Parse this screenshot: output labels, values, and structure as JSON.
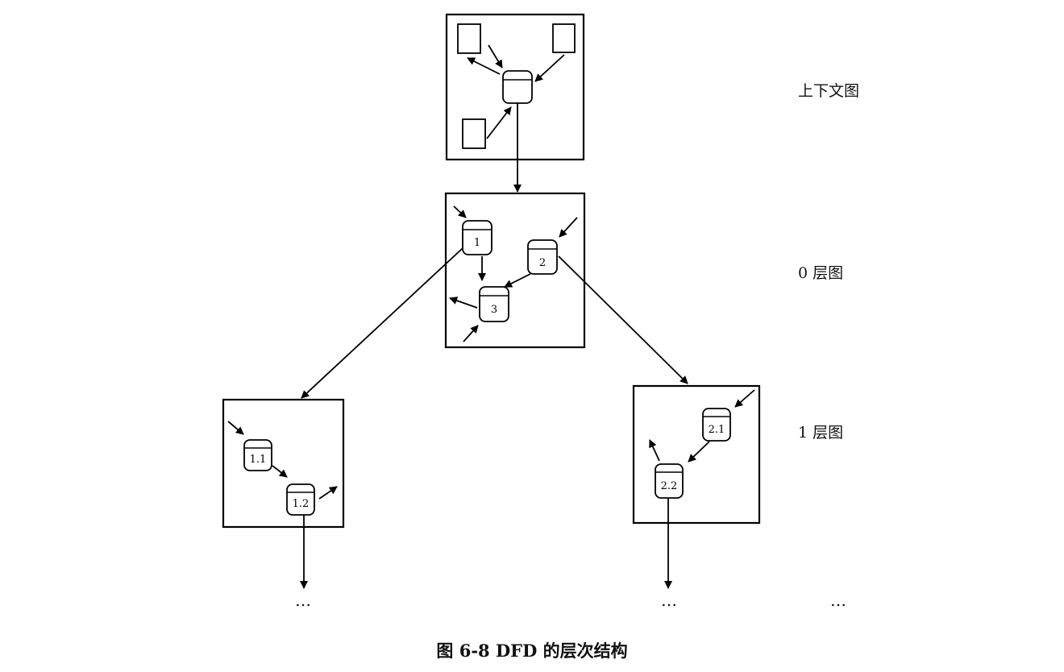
{
  "labels": {
    "context": "上下文图",
    "level0": "0 层图",
    "level1": "1 层图"
  },
  "processes": {
    "p1": "1",
    "p2": "2",
    "p3": "3",
    "p1_1": "1.1",
    "p1_2": "1.2",
    "p2_1": "2.1",
    "p2_2": "2.2"
  },
  "continuation": {
    "left": "…",
    "middle": "…",
    "right": "…"
  },
  "caption": "图 6-8   DFD 的层次结构"
}
